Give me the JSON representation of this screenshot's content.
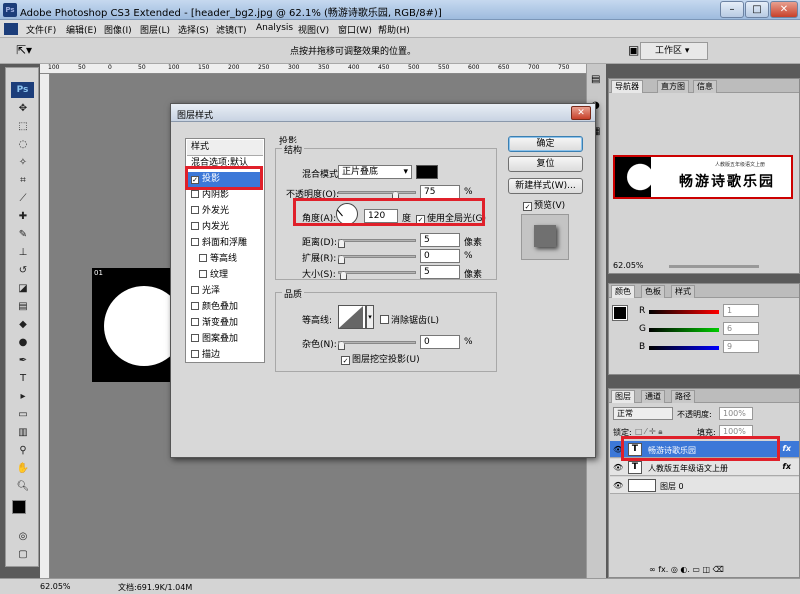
{
  "window": {
    "title": "Adobe Photoshop CS3 Extended - [header_bg2.jpg @ 62.1% (畅游诗歌乐园, RGB/8#)]",
    "app_icon": "Ps",
    "min": "–",
    "max": "□",
    "close": "✕"
  },
  "menu": [
    "文件(F)",
    "编辑(E)",
    "图像(I)",
    "图层(L)",
    "选择(S)",
    "滤镜(T)",
    "Analysis",
    "视图(V)",
    "窗口(W)",
    "帮助(H)"
  ],
  "options": {
    "hint": "点按并拖移可调整效果的位置。",
    "workspace": "工作区 ▾"
  },
  "toolbox": {
    "logo": "Ps"
  },
  "ruler": [
    "100",
    "50",
    "0",
    "50",
    "100",
    "150",
    "200",
    "250",
    "300",
    "350",
    "400",
    "450",
    "500",
    "550",
    "600",
    "650",
    "700",
    "750"
  ],
  "doc_tab": "01",
  "status": {
    "zoom": "62.05%",
    "doc": "文档:691.9K/1.04M"
  },
  "navigator": {
    "tabs": [
      "导航器",
      "直方图",
      "信息"
    ],
    "zoom": "62.05%",
    "banner_text": "畅游诗歌乐园",
    "banner_small": "人教版五年级语文上册"
  },
  "color": {
    "tabs": [
      "颜色",
      "色板",
      "样式"
    ],
    "r_label": "R",
    "g_label": "G",
    "b_label": "B",
    "r": "1",
    "g": "6",
    "b": "9"
  },
  "layers": {
    "tabs": [
      "图层",
      "通道",
      "路径"
    ],
    "blend": "正常",
    "opacity_label": "不透明度:",
    "opacity": "100%",
    "lock_label": "锁定:",
    "fill_label": "填充:",
    "fill": "100%",
    "rows": [
      {
        "name": "畅游诗歌乐园",
        "thumb": "T",
        "fx": "fx"
      },
      {
        "name": "人教版五年级语文上册",
        "thumb": "T",
        "fx": "fx"
      },
      {
        "name": "图层 0",
        "thumb": "",
        "fx": ""
      }
    ],
    "footer": "∞ fx. ◎ ◐. ▭ ◫ ⌫"
  },
  "dialog": {
    "title": "图层样式",
    "close": "✕",
    "styles_header": "样式",
    "blend_defaults": "混合选项:默认",
    "effects": [
      "投影",
      "内阴影",
      "外发光",
      "内发光",
      "斜面和浮雕",
      "等高线",
      "纹理",
      "光泽",
      "颜色叠加",
      "渐变叠加",
      "图案叠加",
      "描边"
    ],
    "effect_checks": [
      "✓",
      "",
      "",
      "",
      "",
      "",
      "",
      "",
      "",
      "",
      "",
      ""
    ],
    "section": "投影",
    "structure": "结构",
    "blend_mode_label": "混合模式:",
    "blend_mode": "正片叠底",
    "opacity_label": "不透明度(O):",
    "opacity": "75",
    "pct": "%",
    "angle_label": "角度(A):",
    "angle": "120",
    "deg": "度",
    "global_light_check": "✓",
    "global_light": "使用全局光(G)",
    "distance_label": "距离(D):",
    "distance": "5",
    "spread_label": "扩展(R):",
    "spread": "0",
    "size_label": "大小(S):",
    "size": "5",
    "px": "像素",
    "quality": "品质",
    "contour_label": "等高线:",
    "antialias": "消除锯齿(L)",
    "noise_label": "杂色(N):",
    "noise": "0",
    "knockout_check": "✓",
    "knockout": "图层挖空投影(U)",
    "ok": "确定",
    "reset": "复位",
    "new_style": "新建样式(W)...",
    "preview_check": "✓",
    "preview": "预览(V)"
  },
  "colors": {
    "highlight": "#3c78d8",
    "annotation": "#e0202a"
  }
}
